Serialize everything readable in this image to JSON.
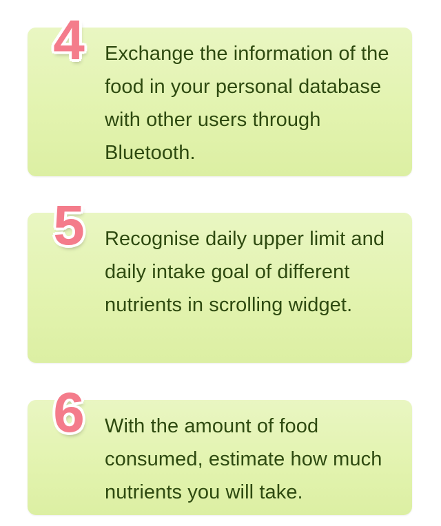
{
  "steps": [
    {
      "number": "4",
      "text": "Exchange the information of the food in your personal database with other users through Bluetooth."
    },
    {
      "number": "5",
      "text": "Recognise daily upper limit and daily intake goal of different nutrients in scrolling widget."
    },
    {
      "number": "6",
      "text": "With the amount of food consumed, estimate how much nutrients you will take."
    }
  ],
  "colors": {
    "card_background": "#e2f3ae",
    "number_color": "#f47c8b",
    "text_color": "#2e4a10"
  }
}
